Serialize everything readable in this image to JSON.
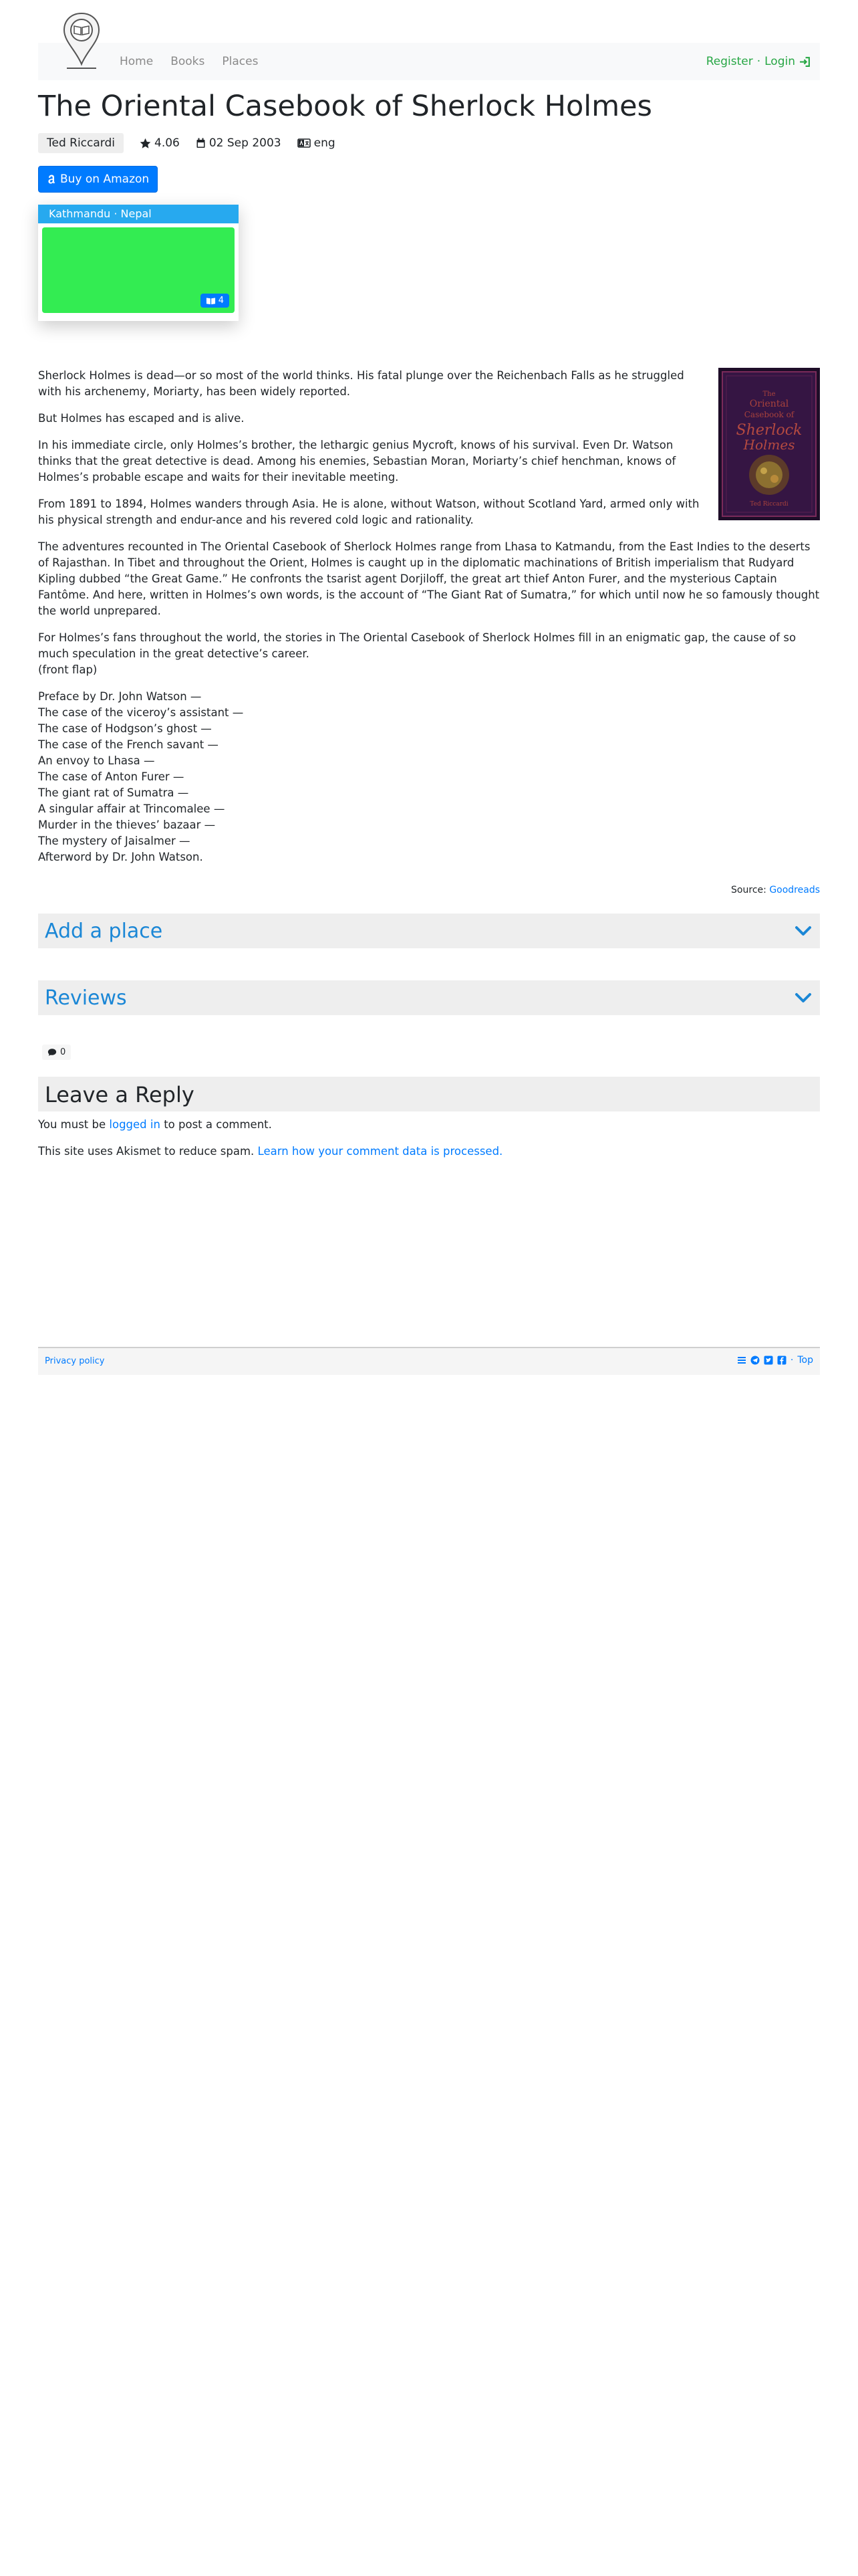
{
  "nav": {
    "links": [
      "Home",
      "Books",
      "Places"
    ],
    "register": "Register",
    "separator": "·",
    "login": "Login"
  },
  "book": {
    "title": "The Oriental Casebook of Sherlock Holmes",
    "author": "Ted Riccardi",
    "rating": "4.06",
    "date": "02 Sep 2003",
    "language": "eng",
    "buy_label": "Buy on Amazon"
  },
  "place": {
    "label": "Kathmandu · Nepal",
    "count": "4"
  },
  "cover": {
    "line1": "The",
    "line2": "Oriental",
    "line3": "Casebook of",
    "line4": "Sherlock",
    "line5": "Holmes",
    "author": "Ted Riccardi"
  },
  "description": {
    "paragraphs": [
      "Sherlock Holmes is dead—or so most of the world thinks. His fatal plunge over the Reichenbach Falls as he struggled with his archenemy, Moriarty, has been widely reported.",
      "But Holmes has escaped and is alive.",
      "In his immediate circle, only Holmes’s brother, the lethargic genius Mycroft, knows of his survival. Even Dr. Watson thinks that the great detective is dead. Among his enemies, Sebastian Moran, Moriarty’s chief henchman, knows of Holmes’s probable escape and waits for their inevitable meeting.",
      "From 1891 to 1894, Holmes wanders through Asia. He is alone, without Watson, without Scotland Yard, armed only with his physical strength and endur-ance and his revered cold logic and rationality.",
      "The adventures recounted in The Oriental Casebook of Sherlock Holmes range from Lhasa to Katmandu, from the East Indies to the deserts of Rajasthan. In Tibet and throughout the Orient, Holmes is caught up in the diplomatic machinations of British imperialism that Rudyard Kipling dubbed “the Great Game.” He confronts the tsarist agent Dorjiloff, the great art thief Anton Furer, and the mysterious Captain Fantôme. And here, written in Holmes’s own words, is the account of “The Giant Rat of Sumatra,” for which until now he so famously thought the world unprepared.",
      "For Holmes’s fans throughout the world, the stories in The Oriental Casebook of Sherlock Holmes fill in an enigmatic gap, the cause of so much speculation in the great detective’s career.",
      "(front flap)"
    ],
    "contents": [
      "Preface by Dr. John Watson —",
      "The case of the viceroy’s assistant —",
      "The case of Hodgson’s ghost —",
      "The case of the French savant —",
      "An envoy to Lhasa —",
      "The case of Anton Furer —",
      "The giant rat of Sumatra —",
      "A singular affair at Trincomalee —",
      "Murder in the thieves’ bazaar —",
      "The mystery of Jaisalmer —",
      "Afterword by Dr. John Watson."
    ]
  },
  "source": {
    "prefix": "Source:",
    "link": "Goodreads"
  },
  "accordions": {
    "add_place": "Add a place",
    "reviews": "Reviews"
  },
  "comments": {
    "count": "0"
  },
  "reply": {
    "title": "Leave a Reply",
    "must_be": "You must be",
    "logged_in": "logged in",
    "to_post": "to post a comment.",
    "akismet": "This site uses Akismet to reduce spam.",
    "akismet_link": "Learn how your comment data is processed."
  },
  "footer": {
    "privacy": "Privacy policy",
    "top": "Top"
  },
  "colors": {
    "primary": "#007bff",
    "success": "#28a745",
    "place_header": "#27a9ef",
    "map": "#33ec52",
    "accordion_title": "#1b87d6"
  },
  "icons": {
    "logo": "map-pin-book-icon",
    "login": "sign-in-icon",
    "rating": "star-icon",
    "date": "calendar-icon",
    "language": "language-icon",
    "amazon": "amazon-icon",
    "books": "book-icon",
    "chevron": "chevron-down-icon",
    "comment": "comment-icon"
  }
}
